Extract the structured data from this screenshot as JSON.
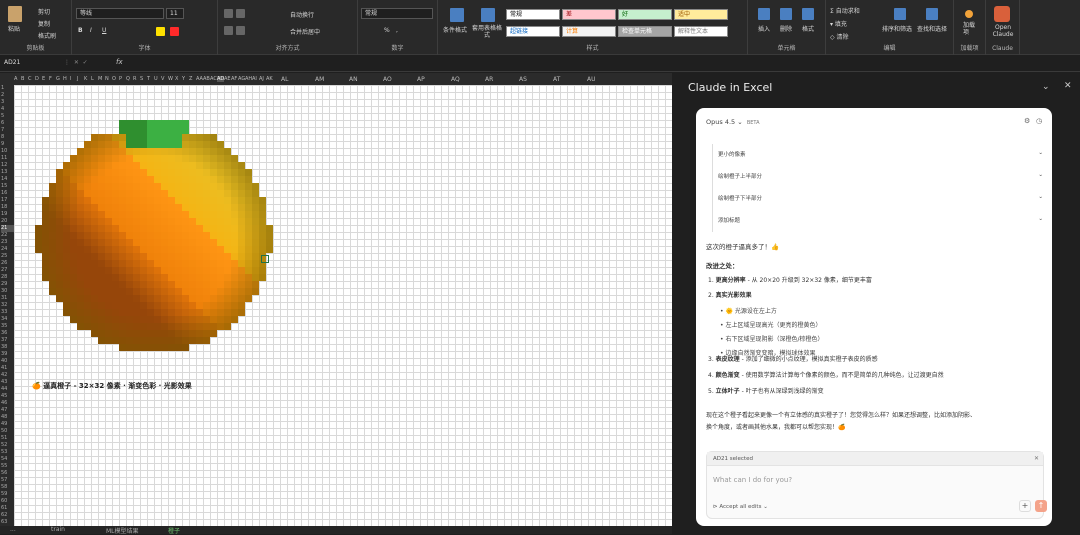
{
  "ribbon": {
    "clipboard": {
      "paste": "粘贴",
      "cut": "剪切",
      "copy": "复制",
      "format_painter": "格式刷",
      "label": "剪贴板"
    },
    "font": {
      "name": "等线",
      "size": "11",
      "label": "字体"
    },
    "alignment": {
      "wrap": "自动换行",
      "merge": "合并后居中",
      "label": "对齐方式"
    },
    "number": {
      "format": "常规",
      "label": "数字"
    },
    "styles": {
      "conditional": "条件格式",
      "table": "套用表格格式",
      "label": "样式",
      "cells": [
        {
          "text": "常规",
          "bg": "#ffffff",
          "color": "#000"
        },
        {
          "text": "差",
          "bg": "#ffc7ce",
          "color": "#9c0006"
        },
        {
          "text": "好",
          "bg": "#c6efce",
          "color": "#006100"
        },
        {
          "text": "适中",
          "bg": "#ffeb9c",
          "color": "#9c5700"
        },
        {
          "text": "超链接",
          "bg": "#ffffff",
          "color": "#0563c1"
        },
        {
          "text": "计算",
          "bg": "#f2f2f2",
          "color": "#fa7d00"
        },
        {
          "text": "检查单元格",
          "bg": "#a5a5a5",
          "color": "#ffffff"
        },
        {
          "text": "解释性文本",
          "bg": "#ffffff",
          "color": "#7f7f7f"
        }
      ]
    },
    "cells_group": {
      "insert": "插入",
      "delete": "删除",
      "format": "格式",
      "label": "单元格"
    },
    "editing": {
      "autosum": "自动求和",
      "fill": "填充",
      "clear": "清除",
      "sort": "排序和筛选",
      "find": "查找和选择",
      "label": "编辑"
    },
    "addins": {
      "addin": "加载项",
      "label": "加载项"
    },
    "claude": {
      "open": "Open Claude",
      "label": "Claude"
    }
  },
  "formula_bar": {
    "name_box": "AD21",
    "fx": "fx",
    "content": ""
  },
  "grid": {
    "col_headers": "A B C D E F G H I J K L M N O P Q R S T U V W X Y Z AA AB AC AD AE AF AG AH AI AJ AK",
    "wide_cols": [
      "AL",
      "AM",
      "AN",
      "AO",
      "AP",
      "AQ",
      "AR",
      "AS",
      "AT",
      "AU"
    ],
    "caption": "🍊 逼真橙子 - 32×32 像素 · 渐变色彩 · 光影效果",
    "selected": "AD21"
  },
  "sheet_tabs": [
    "...",
    "train",
    "ML模型结果",
    "橙子"
  ],
  "panel": {
    "title": "Claude in Excel",
    "model": "Opus 4.5",
    "beta": "BETA",
    "steps": [
      "更小的像素",
      "绘制橙子上半部分",
      "绘制橙子下半部分",
      "添加标题"
    ],
    "msg_intro": "这次的橙子逼真多了！👍",
    "improvements_title": "改进之处：",
    "items": [
      {
        "num": "1.",
        "bold": "更高分辨率",
        "text": " - 从 20×20 升级到 32×32 像素，细节更丰富"
      },
      {
        "num": "2.",
        "bold": "真实光影效果",
        "text": ""
      },
      {
        "num": "3.",
        "bold": "表皮纹理",
        "text": " - 添加了细微的小点纹理，模拟真实橙子表皮的质感"
      },
      {
        "num": "4.",
        "bold": "颜色渐变",
        "text": " - 使用数学算法计算每个像素的颜色，而不是简单的几种纯色，让过渡更自然"
      },
      {
        "num": "5.",
        "bold": "立体叶子",
        "text": " - 叶子也有从深绿到浅绿的渐变"
      }
    ],
    "bullets": [
      "🌞 光源设在左上方",
      "左上区域呈现高光（更亮的橙黄色）",
      "右下区域呈现阴影（深橙色/棕橙色）",
      "边缘自然渐变变暗，模拟球体效果"
    ],
    "closing1": "现在这个橙子看起来更像一个有立体感的真实橙子了！您觉得怎么样？如果还想调整，比如添加阴影、",
    "closing2": "换个角度，或者画其他水果，我都可以帮您实现！🍊",
    "selection_chip": "AD21 selected",
    "input_placeholder": "What can I do for you?",
    "accept_label": "Accept all edits"
  }
}
